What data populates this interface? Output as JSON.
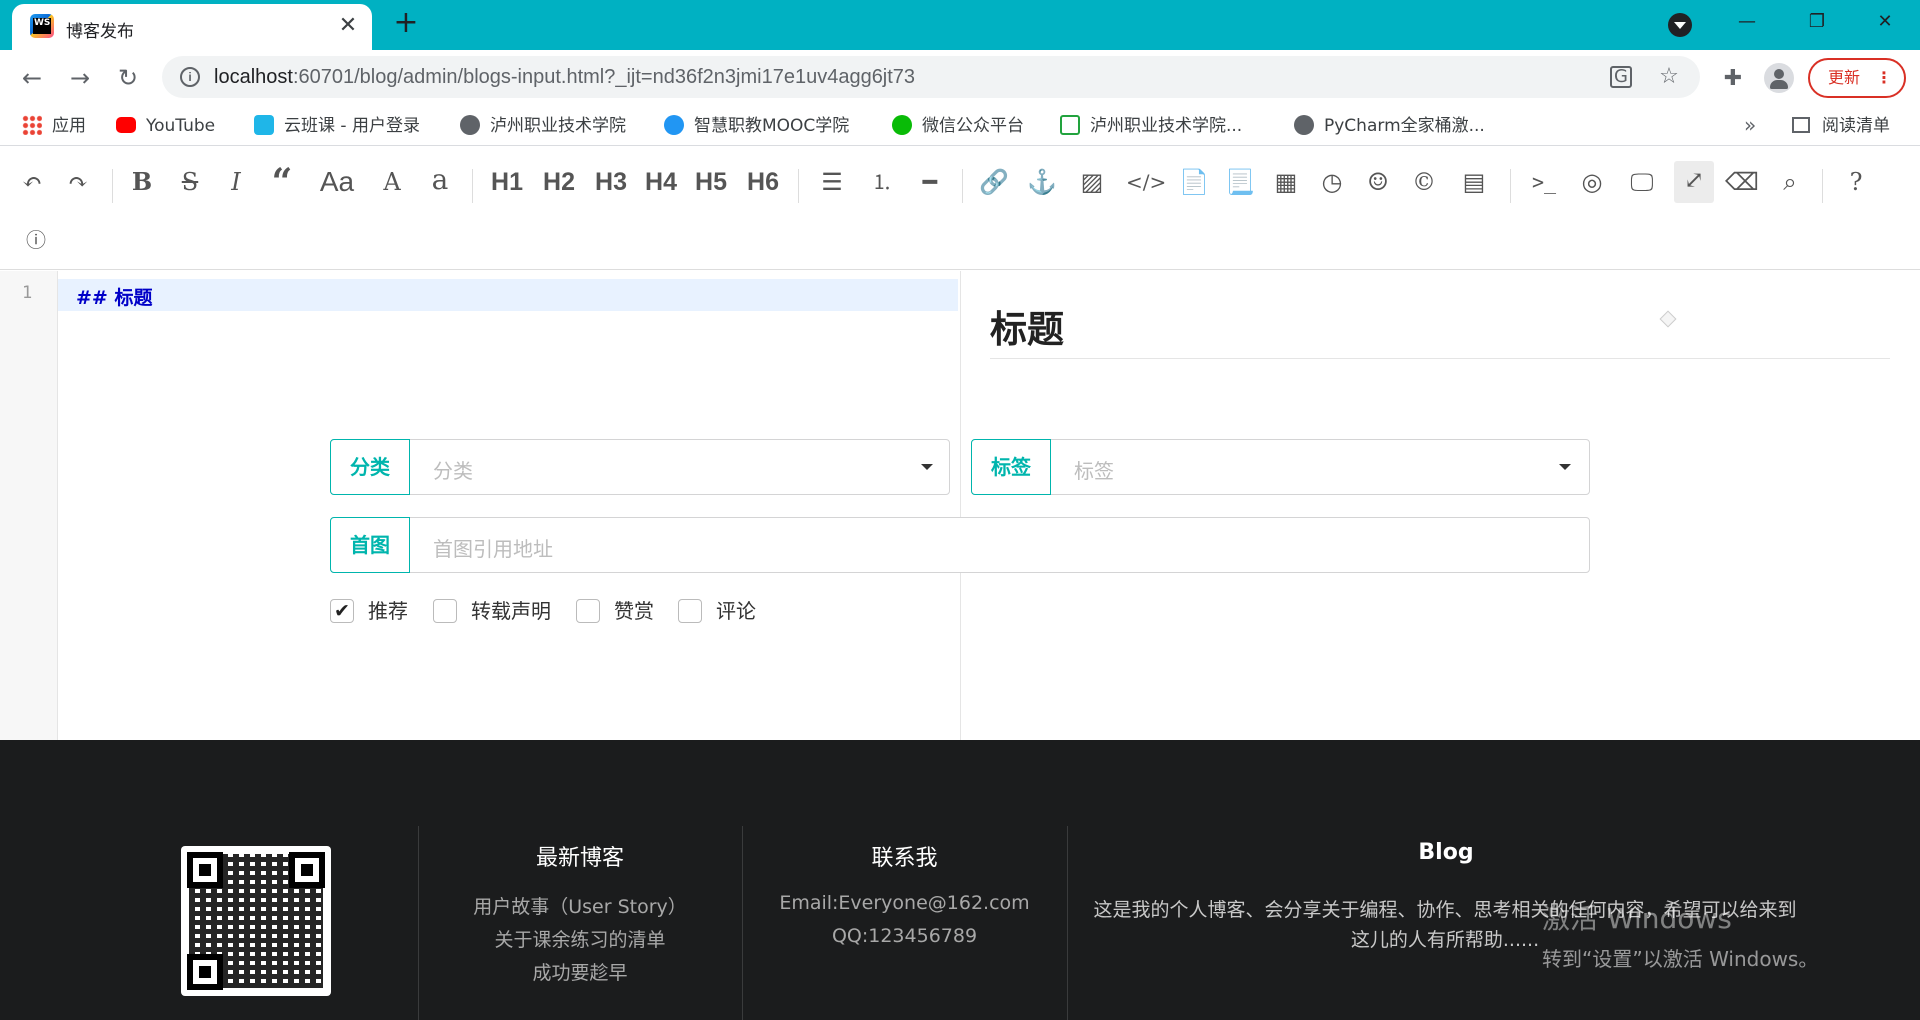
{
  "browser": {
    "tab_title": "博客发布",
    "tab_favicon_text": "WS",
    "url_host": "localhost",
    "url_rest": ":60701/blog/admin/blogs-input.html?_ijt=nd36f2n3jmi17e1uv4agg6jt73",
    "update_label": "更新",
    "reading_list_label": "阅读清单",
    "bookmarks": [
      {
        "label": "应用",
        "icon": "apps-grid-icon",
        "color": "#ea4335"
      },
      {
        "label": "YouTube",
        "icon": "youtube-icon",
        "color": "#ff0000"
      },
      {
        "label": "云班课 - 用户登录",
        "icon": "cloud-icon",
        "color": "#1fb6e8"
      },
      {
        "label": "泸州职业技术学院",
        "icon": "globe-icon",
        "color": "#5f6368"
      },
      {
        "label": "智慧职教MOOC学院",
        "icon": "mooc-icon",
        "color": "#2196f3"
      },
      {
        "label": "微信公众平台",
        "icon": "wechat-icon",
        "color": "#09bb07"
      },
      {
        "label": "泸州职业技术学院...",
        "icon": "dna-icon",
        "color": "#22a33e"
      },
      {
        "label": "PyCharm全家桶激...",
        "icon": "globe-icon",
        "color": "#5f6368"
      }
    ]
  },
  "editor": {
    "line_number": "1",
    "markdown_prefix": "## ",
    "markdown_text": "标题",
    "preview_heading": "标题",
    "toolbar_headings": [
      "H1",
      "H2",
      "H3",
      "H4",
      "H5",
      "H6"
    ],
    "toolbar_text_buttons": {
      "case_upper": "Aa",
      "case_big": "A",
      "case_small": "a"
    }
  },
  "form": {
    "category_label": "分类",
    "category_placeholder": "分类",
    "tag_label": "标签",
    "tag_placeholder": "标签",
    "cover_label": "首图",
    "cover_placeholder": "首图引用地址",
    "checkboxes": [
      {
        "label": "推荐",
        "checked": true
      },
      {
        "label": "转载声明",
        "checked": false
      },
      {
        "label": "赞赏",
        "checked": false
      },
      {
        "label": "评论",
        "checked": false
      }
    ]
  },
  "footer": {
    "latest_title": "最新博客",
    "latest_items": [
      "用户故事（User Story）",
      "关于课余练习的清单",
      "成功要趁早"
    ],
    "contact_title": "联系我",
    "contact_email": "Email:Everyone@162.com",
    "contact_qq": "QQ:123456789",
    "blog_title": "Blog",
    "blog_desc": "这是我的个人博客、会分享关于编程、协作、思考相关的任何内容，希望可以给来到这儿的人有所帮助......",
    "activate_line1": "激活 Windows",
    "activate_line2": "转到“设置”以激活 Windows。"
  },
  "colors": {
    "tabstrip": "#00b1c2",
    "accent": "#00b5ad",
    "footer_bg": "#1b1c1d",
    "update_red": "#d93025"
  }
}
